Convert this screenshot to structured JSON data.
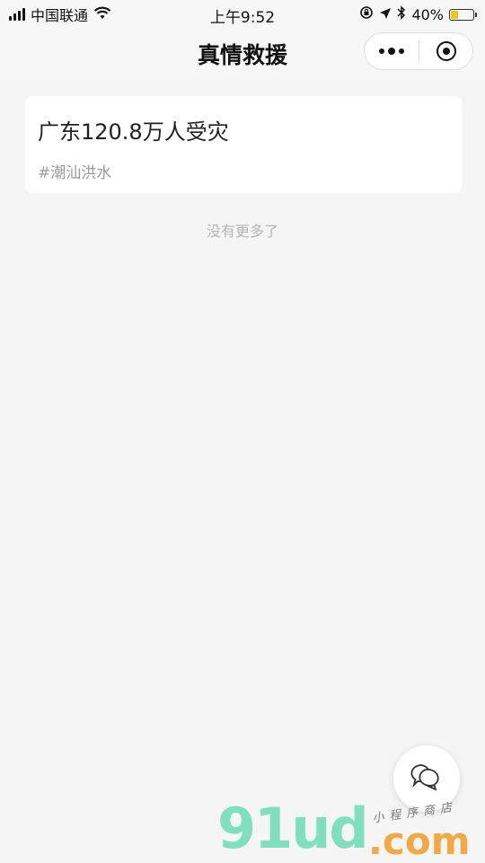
{
  "status_bar": {
    "carrier": "中国联通",
    "time": "上午9:52",
    "battery_percent": "40%",
    "battery_level": 0.4
  },
  "nav": {
    "title": "真情救援"
  },
  "card": {
    "title": "广东120.8万人受灾",
    "tag": "#潮汕洪水"
  },
  "list_end_text": "没有更多了",
  "watermark": {
    "logo": "91ud",
    "domain": ".com",
    "subtitle": "小程序商店"
  },
  "colors": {
    "background": "#f5f5f5",
    "battery_fill": "#f2c318",
    "watermark_green": "#7fe0c0",
    "watermark_orange": "#f3a843"
  },
  "icons": [
    "wifi-icon",
    "orientation-lock-icon",
    "location-arrow-icon",
    "bluetooth-icon",
    "battery-icon",
    "more-dots-icon",
    "close-target-icon",
    "chat-bubbles-icon"
  ]
}
